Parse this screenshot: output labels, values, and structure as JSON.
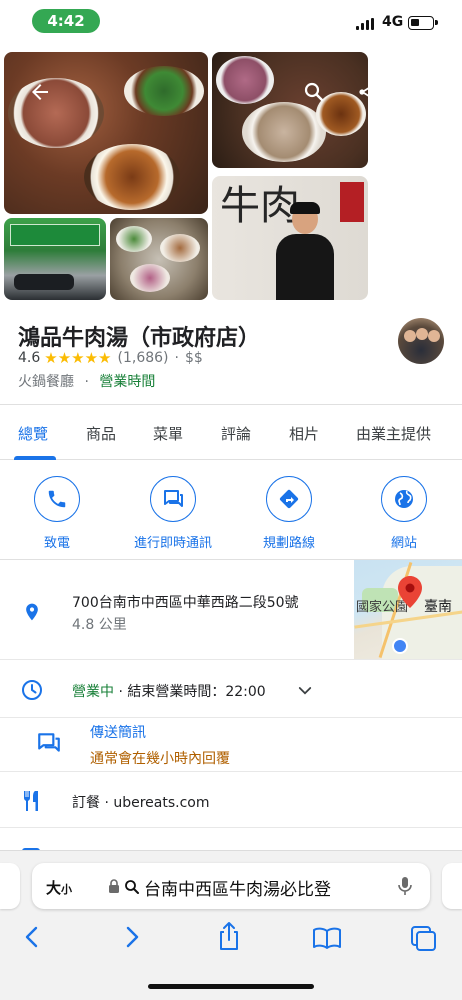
{
  "status_bar": {
    "time": "4:42",
    "network": "4G"
  },
  "place": {
    "name": "鴻品牛肉湯（市政府店）",
    "rating": "4.6",
    "stars": "★★★★★",
    "reviews": "(1,686)",
    "separator": "·",
    "price": "$$",
    "category": "火鍋餐廳",
    "hours_link": "營業時間"
  },
  "tabs": [
    {
      "label": "總覽"
    },
    {
      "label": "商品"
    },
    {
      "label": "菜單"
    },
    {
      "label": "評論"
    },
    {
      "label": "相片"
    },
    {
      "label": "由業主提供"
    }
  ],
  "actions": [
    {
      "label": "致電",
      "icon": "phone-icon"
    },
    {
      "label": "進行即時通訊",
      "icon": "chat-icon"
    },
    {
      "label": "規劃路線",
      "icon": "directions-icon"
    },
    {
      "label": "網站",
      "icon": "globe-icon"
    }
  ],
  "address": {
    "line": "700台南市中西區中華西路二段50號",
    "distance": "4.8 公里",
    "map_label_left": "國家公園",
    "map_label_right": "臺南"
  },
  "hours": {
    "status": "營業中",
    "closing": "· 結束營業時間：22:00"
  },
  "message": {
    "title": "傳送簡訊",
    "subtitle": "通常會在幾小時內回覆"
  },
  "order": {
    "text": "訂餐 · ubereats.com"
  },
  "browser": {
    "text_size_label": "大",
    "text_size_small": "小",
    "query": "台南中西區牛肉湯必比登"
  },
  "colors": {
    "accent": "#1a73e8",
    "open_green": "#188038",
    "star": "#fbbc04",
    "pill_green": "#34a853"
  }
}
